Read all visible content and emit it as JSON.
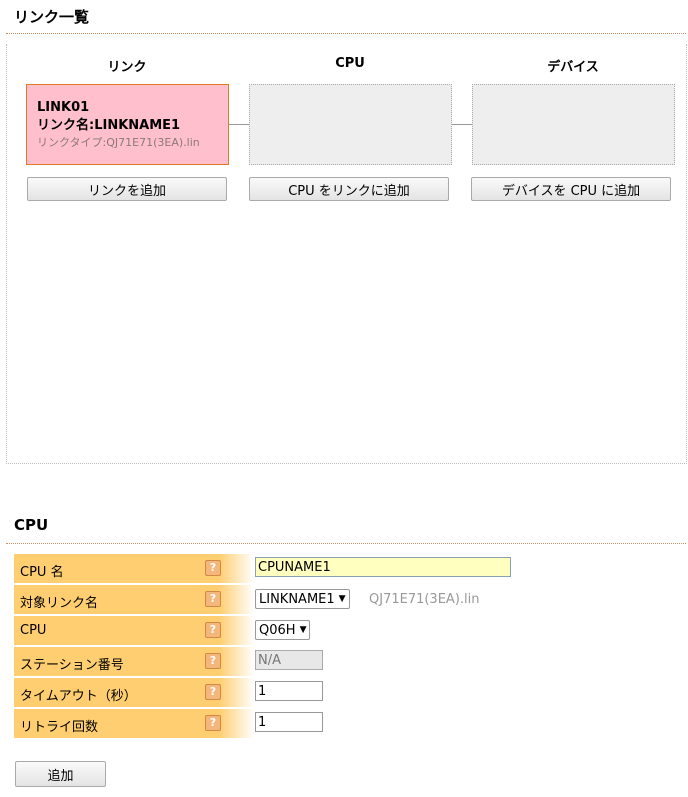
{
  "link_list": {
    "title": "リンク一覧",
    "columns": [
      "リンク",
      "CPU",
      "デバイス"
    ],
    "link_card": {
      "name": "LINK01",
      "link_name_line": "リンク名:LINKNAME1",
      "link_type_line": "リンクタイプ:QJ71E71(3EA).lin"
    },
    "buttons": {
      "add_link": "リンクを追加",
      "add_cpu": "CPU をリンクに追加",
      "add_device": "デバイスを CPU に追加"
    }
  },
  "cpu_form": {
    "title": "CPU",
    "help_glyph": "?",
    "rows": [
      {
        "label": "CPU 名",
        "value": "CPUNAME1"
      },
      {
        "label": "対象リンク名",
        "value": "LINKNAME1",
        "hint": "QJ71E71(3EA).lin"
      },
      {
        "label": "CPU",
        "value": "Q06H"
      },
      {
        "label": "ステーション番号",
        "value": "N/A"
      },
      {
        "label": "タイムアウト（秒）",
        "value": "1"
      },
      {
        "label": "リトライ回数",
        "value": "1"
      }
    ],
    "submit_label": "追加"
  },
  "colors": {
    "accent_rule": "#c8906a",
    "label_bg": "#ffce70",
    "selected_card_bg": "#ffbfcc",
    "selected_card_border": "#e07a2a",
    "name_input_bg": "#ffffc0"
  }
}
